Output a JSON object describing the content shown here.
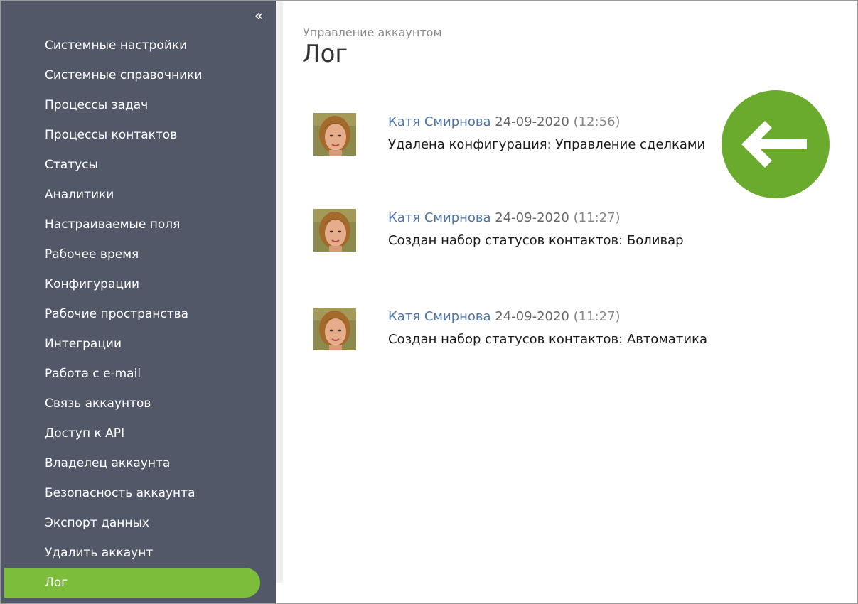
{
  "sidebar": {
    "collapse_glyph": "«",
    "items": [
      {
        "label": "Системные настройки"
      },
      {
        "label": "Системные справочники"
      },
      {
        "label": "Процессы задач"
      },
      {
        "label": "Процессы контактов"
      },
      {
        "label": "Статусы"
      },
      {
        "label": "Аналитики"
      },
      {
        "label": "Настраиваемые поля"
      },
      {
        "label": "Рабочее время"
      },
      {
        "label": "Конфигурации"
      },
      {
        "label": "Рабочие пространства"
      },
      {
        "label": "Интеграции"
      },
      {
        "label": "Работа с e-mail"
      },
      {
        "label": "Связь аккаунтов"
      },
      {
        "label": "Доступ к API"
      },
      {
        "label": "Владелец аккаунта"
      },
      {
        "label": "Безопасность аккаунта"
      },
      {
        "label": "Экспорт данных"
      },
      {
        "label": "Удалить аккаунт"
      },
      {
        "label": "Лог",
        "active": true
      }
    ]
  },
  "header": {
    "breadcrumb": "Управление аккаунтом",
    "title": "Лог"
  },
  "log": {
    "entries": [
      {
        "author": "Катя Смирнова",
        "date": "24-09-2020",
        "time": "(12:56)",
        "text": "Удалена конфигурация: Управление сделками"
      },
      {
        "author": "Катя Смирнова",
        "date": "24-09-2020",
        "time": "(11:27)",
        "text": "Создан набор статусов контактов: Боливар"
      },
      {
        "author": "Катя Смирнова",
        "date": "24-09-2020",
        "time": "(11:27)",
        "text": "Создан набор статусов контактов: Автоматика"
      }
    ]
  },
  "icons": {
    "collapse": "double-chevron-left-icon",
    "back": "arrow-left-icon",
    "avatar": "user-avatar"
  },
  "colors": {
    "sidebar_bg": "#535869",
    "active_item": "#7cbd3c",
    "back_button": "#6aab2e",
    "author_link": "#4e76a8"
  }
}
